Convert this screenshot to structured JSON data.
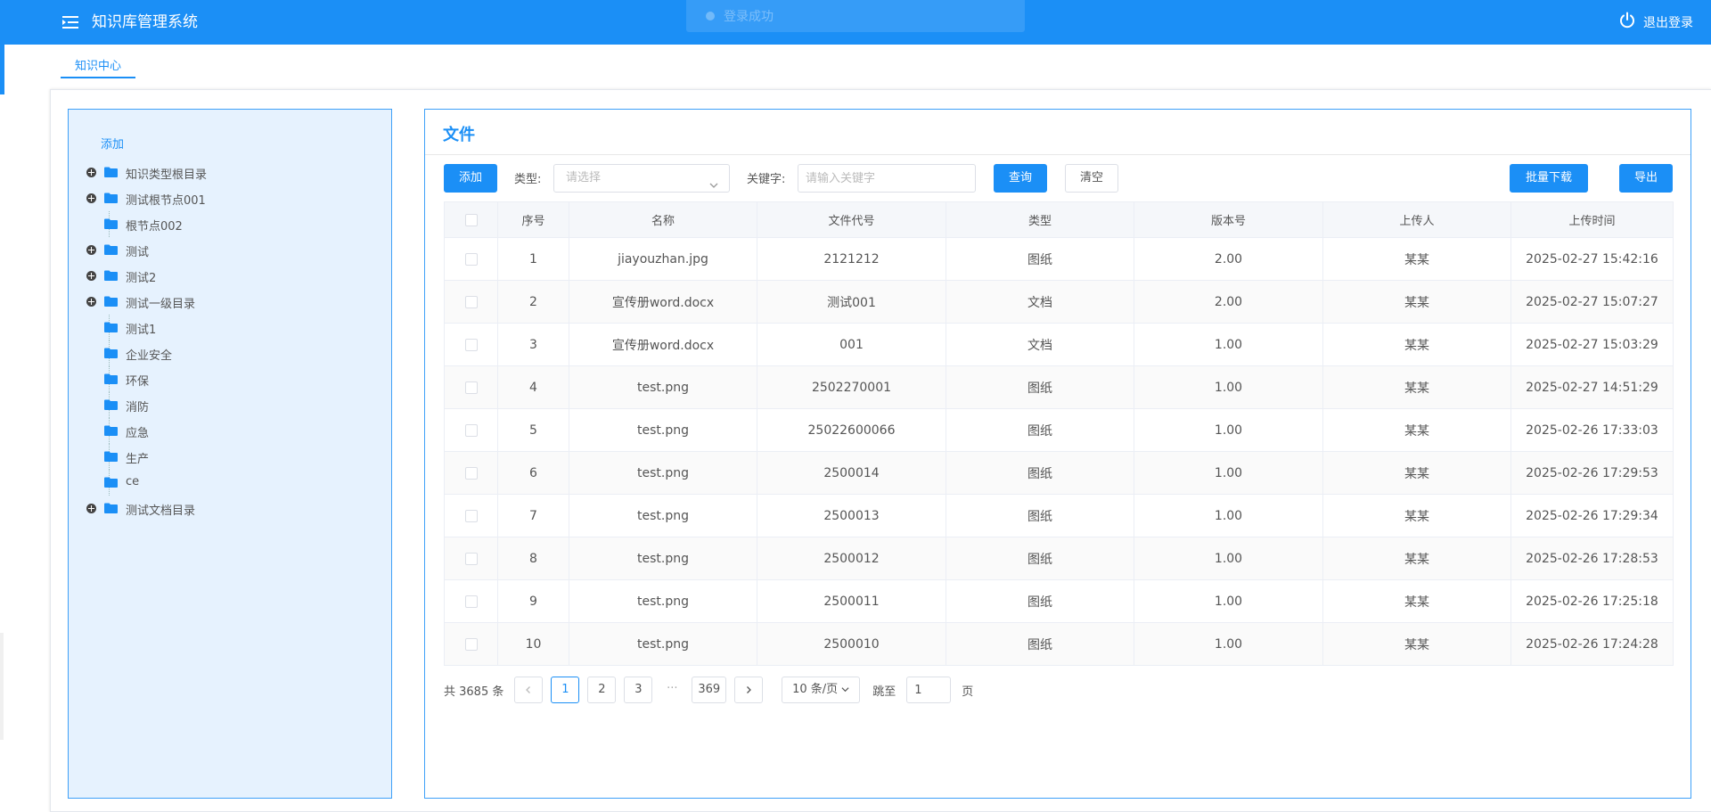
{
  "header": {
    "title": "知识库管理系统",
    "logout_label": "退出登录",
    "toast": "登录成功"
  },
  "tabs": [
    {
      "label": "知识中心"
    }
  ],
  "tree": {
    "add_label": "添加",
    "nodes": [
      {
        "label": "知识类型根目录",
        "expandable": true
      },
      {
        "label": "测试根节点001",
        "expandable": true
      },
      {
        "label": "根节点002",
        "expandable": false
      },
      {
        "label": "测试",
        "expandable": true
      },
      {
        "label": "测试2",
        "expandable": true
      },
      {
        "label": "测试一级目录",
        "expandable": true
      },
      {
        "label": "测试1",
        "expandable": false
      },
      {
        "label": "企业安全",
        "expandable": false
      },
      {
        "label": "环保",
        "expandable": false
      },
      {
        "label": "消防",
        "expandable": false
      },
      {
        "label": "应急",
        "expandable": false
      },
      {
        "label": "生产",
        "expandable": false
      },
      {
        "label": "ce",
        "expandable": false
      },
      {
        "label": "测试文档目录",
        "expandable": true
      }
    ]
  },
  "file": {
    "title": "文件",
    "add_label": "添加",
    "type_label": "类型:",
    "type_placeholder": "请选择",
    "keyword_label": "关键字:",
    "keyword_placeholder": "请输入关键字",
    "search_label": "查询",
    "clear_label": "清空",
    "batch_download_label": "批量下载",
    "export_label": "导出",
    "columns": [
      "序号",
      "名称",
      "文件代号",
      "类型",
      "版本号",
      "上传人",
      "上传时间"
    ],
    "rows": [
      [
        "1",
        "jiayouzhan.jpg",
        "2121212",
        "图纸",
        "2.00",
        "某某",
        "2025-02-27 15:42:16"
      ],
      [
        "2",
        "宣传册word.docx",
        "测试001",
        "文档",
        "2.00",
        "某某",
        "2025-02-27 15:07:27"
      ],
      [
        "3",
        "宣传册word.docx",
        "001",
        "文档",
        "1.00",
        "某某",
        "2025-02-27 15:03:29"
      ],
      [
        "4",
        "test.png",
        "2502270001",
        "图纸",
        "1.00",
        "某某",
        "2025-02-27 14:51:29"
      ],
      [
        "5",
        "test.png",
        "25022600066",
        "图纸",
        "1.00",
        "某某",
        "2025-02-26 17:33:03"
      ],
      [
        "6",
        "test.png",
        "2500014",
        "图纸",
        "1.00",
        "某某",
        "2025-02-26 17:29:53"
      ],
      [
        "7",
        "test.png",
        "2500013",
        "图纸",
        "1.00",
        "某某",
        "2025-02-26 17:29:34"
      ],
      [
        "8",
        "test.png",
        "2500012",
        "图纸",
        "1.00",
        "某某",
        "2025-02-26 17:28:53"
      ],
      [
        "9",
        "test.png",
        "2500011",
        "图纸",
        "1.00",
        "某某",
        "2025-02-26 17:25:18"
      ],
      [
        "10",
        "test.png",
        "2500010",
        "图纸",
        "1.00",
        "某某",
        "2025-02-26 17:24:28"
      ]
    ]
  },
  "pager": {
    "total": "共 3685 条",
    "pages": [
      "1",
      "2",
      "3"
    ],
    "ellipsis": "···",
    "last_page": "369",
    "page_size": "10 条/页",
    "goto_label": "跳至",
    "goto_value": "1",
    "page_suffix": "页"
  },
  "colors": {
    "primary": "#1b8ff6",
    "tree_bg": "#e6f2fe"
  }
}
